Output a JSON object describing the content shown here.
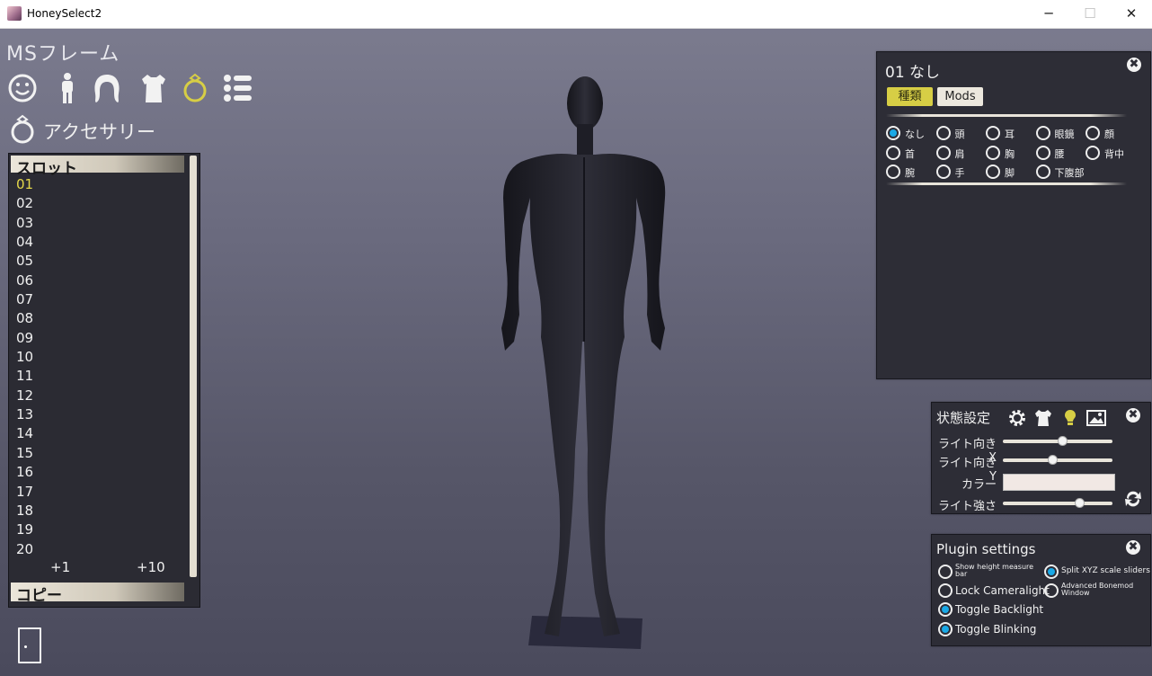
{
  "window": {
    "title": "HoneySelect2",
    "minimize": "─",
    "maximize": "☐",
    "close": "✕"
  },
  "header": {
    "ms_title": "MSフレーム"
  },
  "categories": [
    {
      "name": "face-icon"
    },
    {
      "name": "body-icon"
    },
    {
      "name": "hair-icon"
    },
    {
      "name": "clothes-icon"
    },
    {
      "name": "ring-icon",
      "active": true
    },
    {
      "name": "list-icon"
    }
  ],
  "accessory": {
    "title": "アクセサリー"
  },
  "slots": {
    "header": "スロット",
    "items": [
      "01",
      "02",
      "03",
      "04",
      "05",
      "06",
      "07",
      "08",
      "09",
      "10",
      "11",
      "12",
      "13",
      "14",
      "15",
      "16",
      "17",
      "18",
      "19",
      "20"
    ],
    "active": "01",
    "add_one": "+1",
    "add_ten": "+10",
    "copy": "コピー"
  },
  "acc_panel": {
    "title": "01 なし",
    "tabs": {
      "type": "種類",
      "mods": "Mods"
    },
    "close": "✖",
    "options": [
      "なし",
      "頭",
      "耳",
      "眼鏡",
      "顔",
      "首",
      "肩",
      "胸",
      "腰",
      "背中",
      "腕",
      "手",
      "脚",
      "下腹部"
    ],
    "selected": "なし"
  },
  "state_panel": {
    "title": "状態設定",
    "close": "✖",
    "light_x": "ライト向きX",
    "light_y": "ライト向きY",
    "color": "カラー",
    "light_strength": "ライト強さ",
    "light_x_value": 0.54,
    "light_y_value": 0.45,
    "light_strength_value": 0.7,
    "color_value": "#f1e8e4"
  },
  "plugin_panel": {
    "title": "Plugin settings",
    "close": "✖",
    "show_height": "Show height measure bar",
    "split_xyz": "Split XYZ scale sliders",
    "lock_cameralight": "Lock Cameralight",
    "advanced_bonemod": "Advanced Bonemod Window",
    "toggle_backlight": "Toggle Backlight",
    "toggle_blinking": "Toggle Blinking"
  },
  "colors": {
    "accent_yellow": "#d7ce45",
    "radio_on": "#1aa9e6",
    "panel_bg": "#2d2d36"
  }
}
